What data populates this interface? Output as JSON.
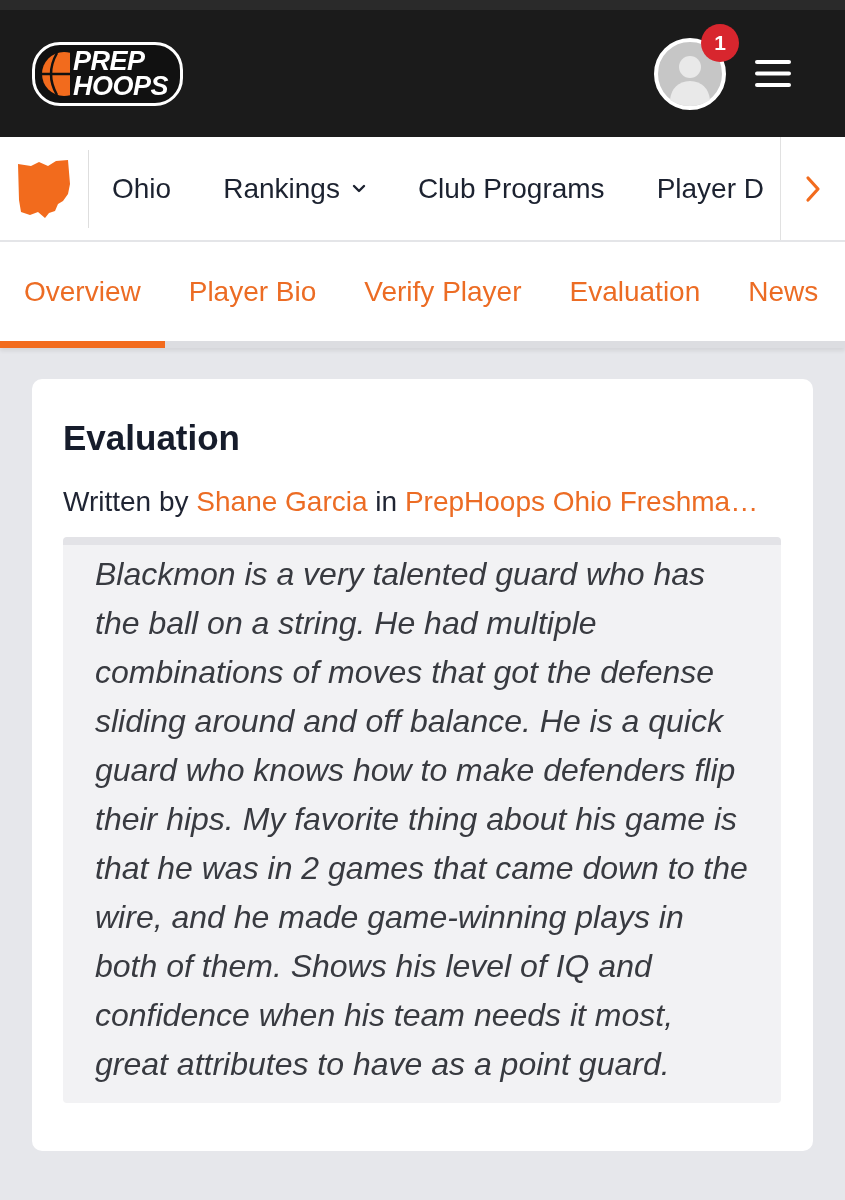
{
  "header": {
    "logo": {
      "lines": [
        "PREP",
        "HOOPS"
      ]
    },
    "notification_count": "1"
  },
  "nav": {
    "items": [
      {
        "label": "Ohio",
        "kind": "link"
      },
      {
        "label": "Rankings",
        "kind": "dropdown"
      },
      {
        "label": "Club Programs",
        "kind": "link"
      },
      {
        "label": "Player D",
        "kind": "link"
      }
    ]
  },
  "tabs": [
    {
      "label": "Overview",
      "selected": true
    },
    {
      "label": "Player Bio",
      "selected": false
    },
    {
      "label": "Verify Player",
      "selected": false
    },
    {
      "label": "Evaluation",
      "selected": false
    },
    {
      "label": "News",
      "selected": false
    }
  ],
  "evaluation": {
    "title": "Evaluation",
    "byline": {
      "prefix": "Written by",
      "author": "Shane Garcia",
      "joiner": "in",
      "source": "PrepHoops Ohio Freshma…"
    },
    "text": "Blackmon is a very talented guard who has the ball on a string. He had multiple combinations of moves that got the defense sliding around and off balance. He is a quick guard who knows how to make defenders flip their hips. My favorite thing about his game is that he was in 2 games that came down to the wire, and he made game-winning plays in both of them. Shows his level of IQ and confidence when his team needs it most, great attributes to have as a point guard."
  }
}
